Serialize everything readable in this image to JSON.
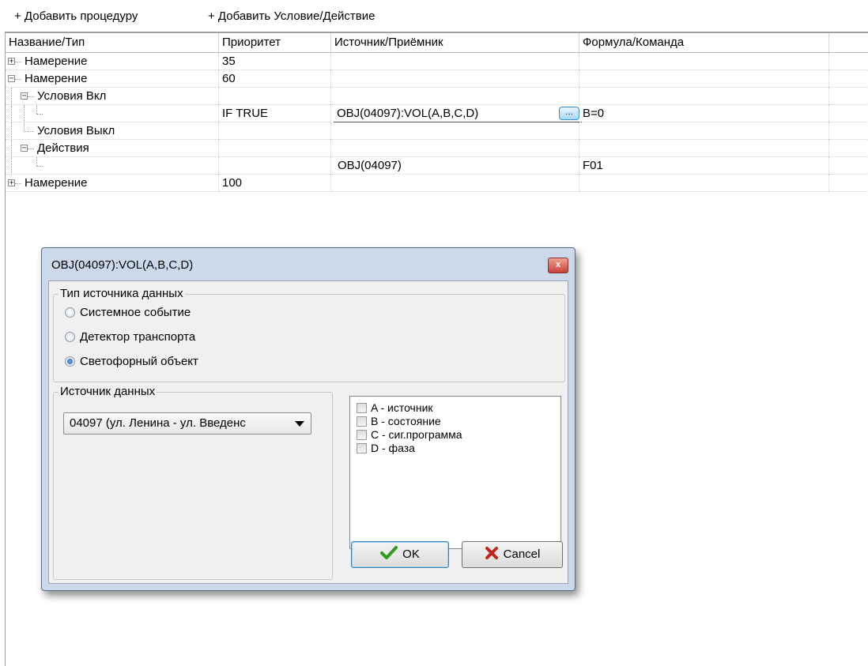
{
  "toolbar": {
    "add_procedure": "+ Добавить процедуру",
    "add_condition": "+ Добавить Условие/Действие"
  },
  "grid": {
    "columns": [
      "Название/Тип",
      "Приоритет",
      "Источник/Приёмник",
      "Формула/Команда"
    ],
    "rows": [
      {
        "name": "Намерение",
        "priority": "35",
        "source": "",
        "formula": "",
        "expander": "+"
      },
      {
        "name": "Намерение",
        "priority": "60",
        "source": "",
        "formula": "",
        "expander": "-"
      },
      {
        "name": "Условия Вкл",
        "priority": "",
        "source": "",
        "formula": "",
        "expander": "-"
      },
      {
        "name": "",
        "priority": "IF TRUE",
        "source": "OBJ(04097):VOL(A,B,C,D)",
        "formula": "B=0",
        "expander": ""
      },
      {
        "name": "Условия Выкл",
        "priority": "",
        "source": "",
        "formula": "",
        "expander": ""
      },
      {
        "name": "Действия",
        "priority": "",
        "source": "",
        "formula": "",
        "expander": "-"
      },
      {
        "name": "",
        "priority": "",
        "source": "OBJ(04097)",
        "formula": "F01",
        "expander": ""
      },
      {
        "name": "Намерение",
        "priority": "100",
        "source": "",
        "formula": "",
        "expander": "+"
      }
    ],
    "ellipsis_label": "..."
  },
  "dialog": {
    "title": "OBJ(04097):VOL(A,B,C,D)",
    "close_label": "x",
    "source_type_group": "Тип источника данных",
    "radios": [
      {
        "label": "Системное событие",
        "selected": false
      },
      {
        "label": "Детектор транспорта",
        "selected": false
      },
      {
        "label": "Светофорный объект",
        "selected": true
      }
    ],
    "source_group": "Источник данных",
    "source_combo_value": "04097 (ул. Ленина - ул. Введенс",
    "checks": [
      {
        "label": "A - источник",
        "checked": false
      },
      {
        "label": "B - состояние",
        "checked": false
      },
      {
        "label": "C - сиг.программа",
        "checked": false
      },
      {
        "label": "D - фаза",
        "checked": false
      }
    ],
    "ok_label": "OK",
    "cancel_label": "Cancel"
  },
  "colors": {
    "ok_check": "#2f9a1b",
    "cancel_x": "#c3241a",
    "dialog_frame": "#cbd9ea"
  }
}
